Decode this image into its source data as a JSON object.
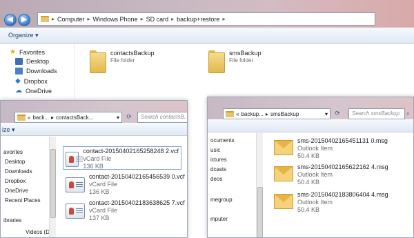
{
  "main": {
    "breadcrumb": [
      "Computer",
      "Windows Phone",
      "SD card",
      "backup+restore"
    ],
    "organize_label": "Organize",
    "nav": {
      "favorites_label": "Favorites",
      "items": [
        "Desktop",
        "Downloads",
        "Dropbox",
        "OneDrive"
      ]
    },
    "folders": [
      {
        "name": "contactsBackup",
        "type": "File folder"
      },
      {
        "name": "smsBackup",
        "type": "File folder"
      }
    ]
  },
  "contacts_window": {
    "address": [
      "back...",
      "contactsBack..."
    ],
    "search_placeholder": "Search contactsB...",
    "organize_fragment": "ize",
    "nav_items": [
      "avorites",
      "Desktop",
      "Downloads",
      "Dropbox",
      "OneDrive",
      "Recent Places",
      "ibraries",
      "Videos (D:)"
    ],
    "files": [
      {
        "name": "contact-20150402165258248 2.vcf",
        "type": "vCard File",
        "size": "136 KB"
      },
      {
        "name": "contact-20150402165456539 0.vcf",
        "type": "vCard File",
        "size": "136 KB"
      },
      {
        "name": "contact-20150402183638625 7.vcf",
        "type": "vCard File",
        "size": "137 KB"
      }
    ]
  },
  "sms_window": {
    "address": [
      "backup...",
      "smsBackup"
    ],
    "search_placeholder": "Search smsBackup",
    "nav_items": [
      "ocuments",
      "usic",
      "ictures",
      "dcasts",
      "deos",
      "megroup",
      "mputer"
    ],
    "files": [
      {
        "name": "sms-20150402165451131 0.msg",
        "type": "Outlook Item",
        "size": "50.4 KB"
      },
      {
        "name": "sms-20150402165622162 4.msg",
        "type": "Outlook Item",
        "size": "50.4 KB"
      },
      {
        "name": "sms-20150402183806404 4.msg",
        "type": "Outlook Item",
        "size": "50.4 KB"
      }
    ]
  }
}
